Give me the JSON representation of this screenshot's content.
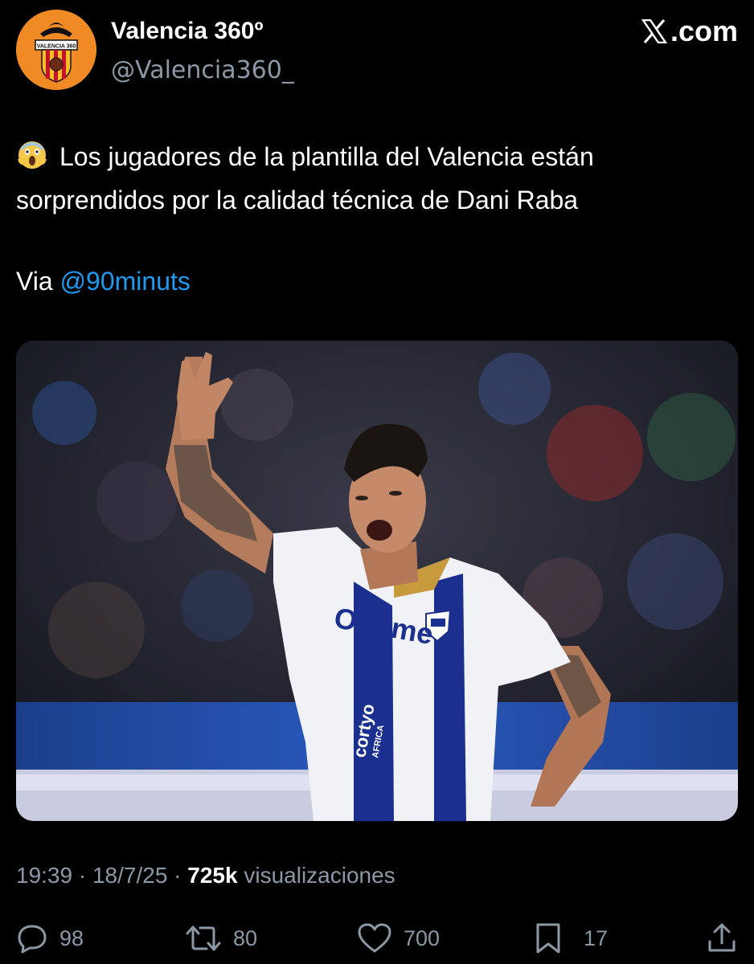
{
  "author": {
    "name": "Valencia 360º",
    "handle": "@Valencia360_",
    "avatar_icon": "valencia-360-badge",
    "avatar_color": "#f08a24"
  },
  "site": {
    "label": ".com",
    "icon": "x-logo-icon"
  },
  "tweet": {
    "emoji": "face-screaming-in-fear",
    "line1": "Los jugadores de la plantilla del Valencia están",
    "line2": "sorprendidos por la calidad técnica de Dani Raba",
    "via_prefix": "Via ",
    "mention": "@90minuts",
    "mention_color": "#1d9bf0"
  },
  "media": {
    "image": "football-player-celebrating-photo",
    "shirt_sponsor": "Ontime",
    "sleeve_sponsor": "cortyo",
    "sleeve_sub": "AFRICA"
  },
  "meta": {
    "time": "19:39",
    "date": "18/7/25",
    "views_count": "725k",
    "views_label": "visualizaciones",
    "separator": "·"
  },
  "actions": {
    "replies": "98",
    "reposts": "80",
    "likes": "700",
    "bookmarks": "17"
  }
}
